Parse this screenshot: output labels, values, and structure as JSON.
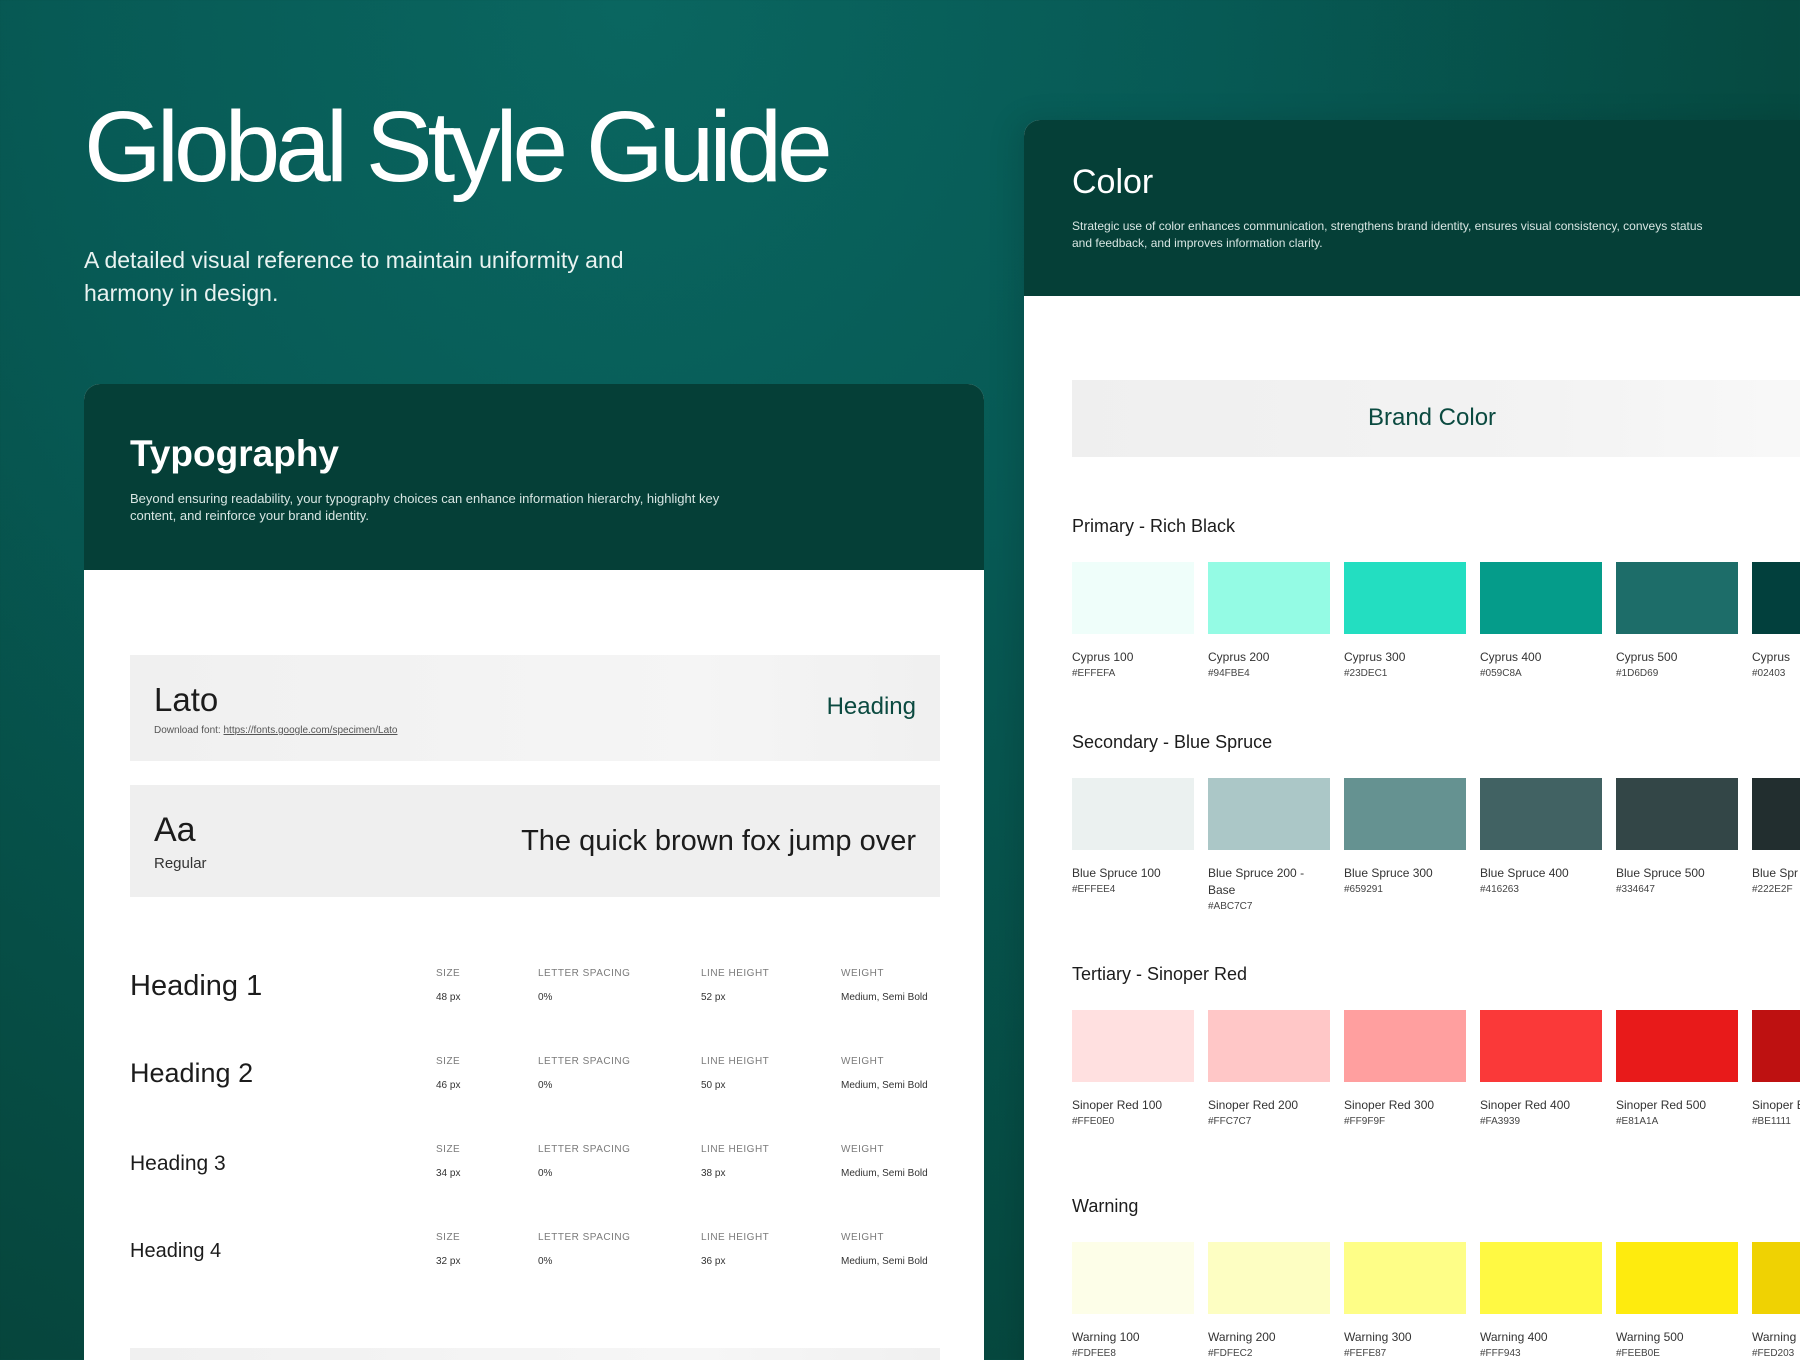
{
  "hero": {
    "title": "Global Style Guide",
    "subtitle": "A detailed visual reference to maintain uniformity and harmony in design."
  },
  "typography": {
    "title": "Typography",
    "description": "Beyond ensuring readability, your typography choices can enhance information hierarchy, highlight key content, and reinforce your brand identity.",
    "font": {
      "name": "Lato",
      "download_prefix": "Download font:",
      "download_link": "https://fonts.google.com/specimen/Lato",
      "role": "Heading"
    },
    "sample": {
      "glyph": "Aa",
      "weight": "Regular",
      "pangram": "The quick brown fox jump over"
    },
    "spec_labels": {
      "size": "SIZE",
      "letter_spacing": "LETTER SPACING",
      "line_height": "LINE HEIGHT",
      "weight": "WEIGHT"
    },
    "scale": [
      {
        "name": "Heading 1",
        "size": "48 px",
        "letter_spacing": "0%",
        "line_height": "52 px",
        "weight": "Medium, Semi Bold"
      },
      {
        "name": "Heading 2",
        "size": "46 px",
        "letter_spacing": "0%",
        "line_height": "50 px",
        "weight": "Medium, Semi Bold"
      },
      {
        "name": "Heading 3",
        "size": "34 px",
        "letter_spacing": "0%",
        "line_height": "38 px",
        "weight": "Medium, Semi Bold"
      },
      {
        "name": "Heading 4",
        "size": "32 px",
        "letter_spacing": "0%",
        "line_height": "36 px",
        "weight": "Medium, Semi Bold"
      }
    ]
  },
  "color": {
    "title": "Color",
    "description": "Strategic use of color enhances communication, strengthens brand identity, ensures visual consistency, conveys status and feedback, and improves information clarity.",
    "brand_bar": "Brand Color",
    "palettes": [
      {
        "title": "Primary - Rich Black",
        "swatches": [
          {
            "name": "Cyprus 100",
            "hex": "#EFFEFA",
            "color": "#EFFEFA"
          },
          {
            "name": "Cyprus 200",
            "hex": "#94FBE4",
            "color": "#94FBE4"
          },
          {
            "name": "Cyprus 300",
            "hex": "#23DEC1",
            "color": "#23DEC1"
          },
          {
            "name": "Cyprus 400",
            "hex": "#059C8A",
            "color": "#059C8A"
          },
          {
            "name": "Cyprus 500",
            "hex": "#1D6D69",
            "color": "#1D6D69"
          },
          {
            "name": "Cyprus",
            "hex": "#02403",
            "color": "#02403D"
          }
        ]
      },
      {
        "title": "Secondary - Blue Spruce",
        "swatches": [
          {
            "name": "Blue Spruce 100",
            "hex": "#EFFEE4",
            "color": "#EBF1F0"
          },
          {
            "name": "Blue Spruce 200 - Base",
            "hex": "#ABC7C7",
            "color": "#ABC7C7"
          },
          {
            "name": "Blue Spruce 300",
            "hex": "#659291",
            "color": "#659291"
          },
          {
            "name": "Blue Spruce 400",
            "hex": "#416263",
            "color": "#416263"
          },
          {
            "name": "Blue Spruce 500",
            "hex": "#334647",
            "color": "#334647"
          },
          {
            "name": "Blue Spr",
            "hex": "#222E2F",
            "color": "#222E2F"
          }
        ]
      },
      {
        "title": "Tertiary - Sinoper Red",
        "swatches": [
          {
            "name": "Sinoper Red 100",
            "hex": "#FFE0E0",
            "color": "#FFE0E0"
          },
          {
            "name": "Sinoper Red 200",
            "hex": "#FFC7C7",
            "color": "#FFC7C7"
          },
          {
            "name": "Sinoper Red 300",
            "hex": "#FF9F9F",
            "color": "#FF9F9F"
          },
          {
            "name": "Sinoper Red 400",
            "hex": "#FA3939",
            "color": "#FA3939"
          },
          {
            "name": "Sinoper Red 500",
            "hex": "#E81A1A",
            "color": "#E81A1A"
          },
          {
            "name": "Sinoper Base",
            "hex": "#BE1111",
            "color": "#BE1111"
          }
        ]
      },
      {
        "title": "Warning",
        "swatches": [
          {
            "name": "Warning 100",
            "hex": "#FDFEE8",
            "color": "#FDFEE8"
          },
          {
            "name": "Warning 200",
            "hex": "#FDFEC2",
            "color": "#FDFEC2"
          },
          {
            "name": "Warning 300",
            "hex": "#FEFE87",
            "color": "#FEFE87"
          },
          {
            "name": "Warning 400",
            "hex": "#FFF943",
            "color": "#FFF943"
          },
          {
            "name": "Warning 500",
            "hex": "#FEEB0E",
            "color": "#FEEB0E"
          },
          {
            "name": "Warning",
            "hex": "#FED203",
            "color": "#EFD203"
          }
        ]
      }
    ]
  }
}
